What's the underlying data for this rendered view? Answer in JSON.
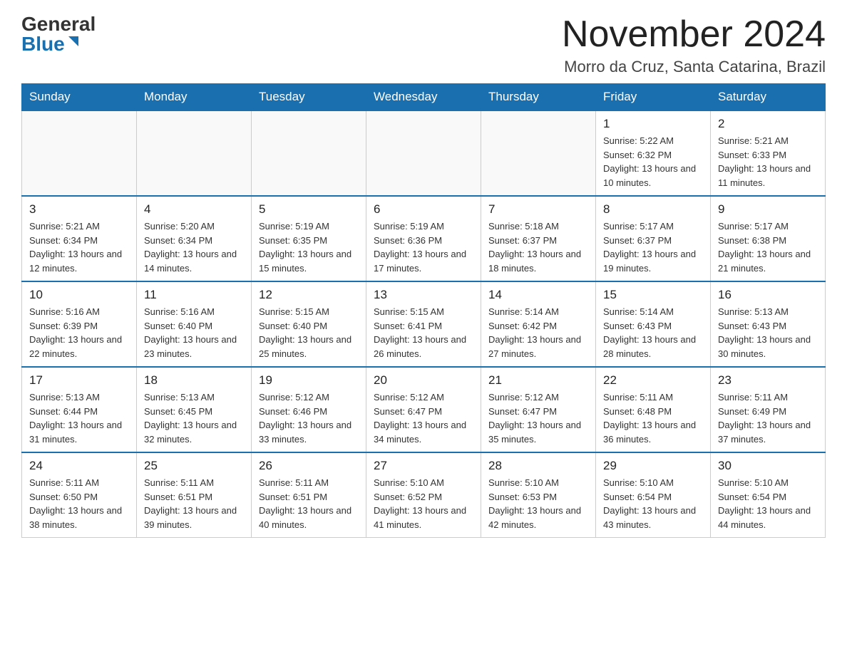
{
  "logo": {
    "general": "General",
    "blue": "Blue"
  },
  "title": {
    "month_year": "November 2024",
    "location": "Morro da Cruz, Santa Catarina, Brazil"
  },
  "weekdays": [
    "Sunday",
    "Monday",
    "Tuesday",
    "Wednesday",
    "Thursday",
    "Friday",
    "Saturday"
  ],
  "weeks": [
    [
      {
        "day": "",
        "info": ""
      },
      {
        "day": "",
        "info": ""
      },
      {
        "day": "",
        "info": ""
      },
      {
        "day": "",
        "info": ""
      },
      {
        "day": "",
        "info": ""
      },
      {
        "day": "1",
        "info": "Sunrise: 5:22 AM\nSunset: 6:32 PM\nDaylight: 13 hours and 10 minutes."
      },
      {
        "day": "2",
        "info": "Sunrise: 5:21 AM\nSunset: 6:33 PM\nDaylight: 13 hours and 11 minutes."
      }
    ],
    [
      {
        "day": "3",
        "info": "Sunrise: 5:21 AM\nSunset: 6:34 PM\nDaylight: 13 hours and 12 minutes."
      },
      {
        "day": "4",
        "info": "Sunrise: 5:20 AM\nSunset: 6:34 PM\nDaylight: 13 hours and 14 minutes."
      },
      {
        "day": "5",
        "info": "Sunrise: 5:19 AM\nSunset: 6:35 PM\nDaylight: 13 hours and 15 minutes."
      },
      {
        "day": "6",
        "info": "Sunrise: 5:19 AM\nSunset: 6:36 PM\nDaylight: 13 hours and 17 minutes."
      },
      {
        "day": "7",
        "info": "Sunrise: 5:18 AM\nSunset: 6:37 PM\nDaylight: 13 hours and 18 minutes."
      },
      {
        "day": "8",
        "info": "Sunrise: 5:17 AM\nSunset: 6:37 PM\nDaylight: 13 hours and 19 minutes."
      },
      {
        "day": "9",
        "info": "Sunrise: 5:17 AM\nSunset: 6:38 PM\nDaylight: 13 hours and 21 minutes."
      }
    ],
    [
      {
        "day": "10",
        "info": "Sunrise: 5:16 AM\nSunset: 6:39 PM\nDaylight: 13 hours and 22 minutes."
      },
      {
        "day": "11",
        "info": "Sunrise: 5:16 AM\nSunset: 6:40 PM\nDaylight: 13 hours and 23 minutes."
      },
      {
        "day": "12",
        "info": "Sunrise: 5:15 AM\nSunset: 6:40 PM\nDaylight: 13 hours and 25 minutes."
      },
      {
        "day": "13",
        "info": "Sunrise: 5:15 AM\nSunset: 6:41 PM\nDaylight: 13 hours and 26 minutes."
      },
      {
        "day": "14",
        "info": "Sunrise: 5:14 AM\nSunset: 6:42 PM\nDaylight: 13 hours and 27 minutes."
      },
      {
        "day": "15",
        "info": "Sunrise: 5:14 AM\nSunset: 6:43 PM\nDaylight: 13 hours and 28 minutes."
      },
      {
        "day": "16",
        "info": "Sunrise: 5:13 AM\nSunset: 6:43 PM\nDaylight: 13 hours and 30 minutes."
      }
    ],
    [
      {
        "day": "17",
        "info": "Sunrise: 5:13 AM\nSunset: 6:44 PM\nDaylight: 13 hours and 31 minutes."
      },
      {
        "day": "18",
        "info": "Sunrise: 5:13 AM\nSunset: 6:45 PM\nDaylight: 13 hours and 32 minutes."
      },
      {
        "day": "19",
        "info": "Sunrise: 5:12 AM\nSunset: 6:46 PM\nDaylight: 13 hours and 33 minutes."
      },
      {
        "day": "20",
        "info": "Sunrise: 5:12 AM\nSunset: 6:47 PM\nDaylight: 13 hours and 34 minutes."
      },
      {
        "day": "21",
        "info": "Sunrise: 5:12 AM\nSunset: 6:47 PM\nDaylight: 13 hours and 35 minutes."
      },
      {
        "day": "22",
        "info": "Sunrise: 5:11 AM\nSunset: 6:48 PM\nDaylight: 13 hours and 36 minutes."
      },
      {
        "day": "23",
        "info": "Sunrise: 5:11 AM\nSunset: 6:49 PM\nDaylight: 13 hours and 37 minutes."
      }
    ],
    [
      {
        "day": "24",
        "info": "Sunrise: 5:11 AM\nSunset: 6:50 PM\nDaylight: 13 hours and 38 minutes."
      },
      {
        "day": "25",
        "info": "Sunrise: 5:11 AM\nSunset: 6:51 PM\nDaylight: 13 hours and 39 minutes."
      },
      {
        "day": "26",
        "info": "Sunrise: 5:11 AM\nSunset: 6:51 PM\nDaylight: 13 hours and 40 minutes."
      },
      {
        "day": "27",
        "info": "Sunrise: 5:10 AM\nSunset: 6:52 PM\nDaylight: 13 hours and 41 minutes."
      },
      {
        "day": "28",
        "info": "Sunrise: 5:10 AM\nSunset: 6:53 PM\nDaylight: 13 hours and 42 minutes."
      },
      {
        "day": "29",
        "info": "Sunrise: 5:10 AM\nSunset: 6:54 PM\nDaylight: 13 hours and 43 minutes."
      },
      {
        "day": "30",
        "info": "Sunrise: 5:10 AM\nSunset: 6:54 PM\nDaylight: 13 hours and 44 minutes."
      }
    ]
  ]
}
